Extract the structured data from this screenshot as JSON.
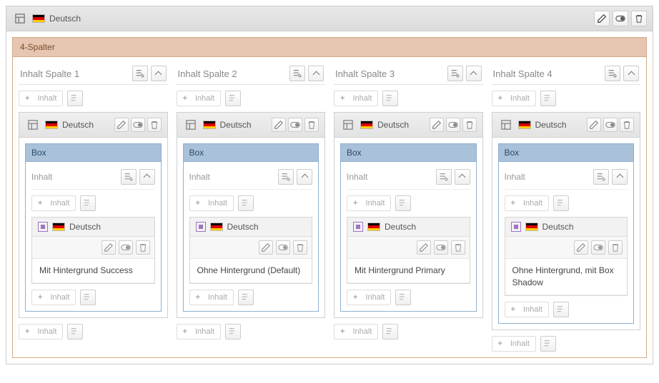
{
  "header": {
    "language_label": "Deutsch"
  },
  "section": {
    "title": "4-Spalter"
  },
  "common": {
    "add_label": "Inhalt",
    "box_label": "Box",
    "inner_lang_label": "Deutsch",
    "content_sub_label": "Inhalt"
  },
  "columns": [
    {
      "title": "Inhalt Spalte 1",
      "content_text": "Mit Hintergrund Success"
    },
    {
      "title": "Inhalt Spalte 2",
      "content_text": "Ohne Hintergrund (Default)"
    },
    {
      "title": "Inhalt Spalte 3",
      "content_text": "Mit Hintergrund Primary"
    },
    {
      "title": "Inhalt Spalte 4",
      "content_text": "Ohne Hintergrund, mit Box Shadow"
    }
  ]
}
